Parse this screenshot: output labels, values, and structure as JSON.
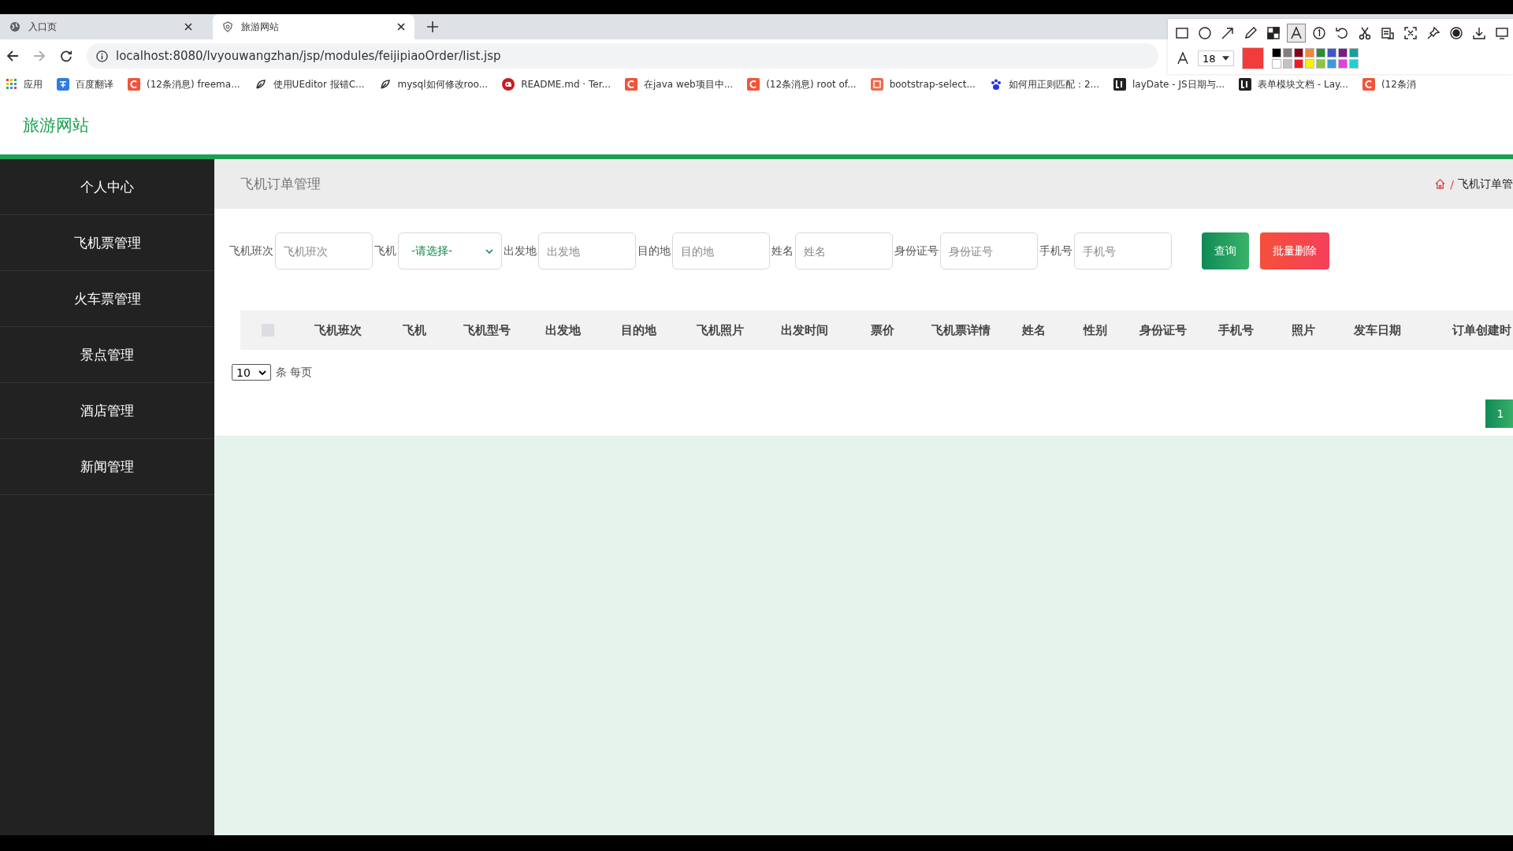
{
  "browser": {
    "tabs": [
      {
        "title": "入口页",
        "kind": "globe",
        "selected": false
      },
      {
        "title": "旅游网站",
        "kind": "shield",
        "selected": true
      }
    ],
    "address": {
      "url": "localhost:8080/lvyouwangzhan/jsp/modules/feijipiaoOrder/list.jsp",
      "forward_disabled": true
    },
    "bookmarks": [
      {
        "label": "应用",
        "kind": "apps"
      },
      {
        "label": "百度翻译",
        "kind": "translate"
      },
      {
        "label": "(12条消息) freema...",
        "kind": "csdn"
      },
      {
        "label": "使用UEditor 报错C...",
        "kind": "leaf"
      },
      {
        "label": "mysql如何修改roo...",
        "kind": "leaf"
      },
      {
        "label": "README.md · Ter...",
        "kind": "gitee"
      },
      {
        "label": "在java web项目中...",
        "kind": "csdn"
      },
      {
        "label": "(12条消息) root of...",
        "kind": "csdn"
      },
      {
        "label": "bootstrap-select...",
        "kind": "orange"
      },
      {
        "label": "如何用正则匹配：2...",
        "kind": "paw"
      },
      {
        "label": "layDate - JS日期与...",
        "kind": "layui"
      },
      {
        "label": "表单模块文档 - Lay...",
        "kind": "layui"
      },
      {
        "label": "(12条消",
        "kind": "csdn"
      }
    ]
  },
  "capture_toolbar": {
    "tools": [
      {
        "kind": "rect",
        "selected": false
      },
      {
        "kind": "ellipse",
        "selected": false
      },
      {
        "kind": "arrow",
        "selected": false
      },
      {
        "kind": "pencil",
        "selected": false
      },
      {
        "kind": "mosaic",
        "selected": false
      },
      {
        "kind": "text",
        "selected": true
      },
      {
        "kind": "number",
        "selected": false
      },
      {
        "kind": "undo",
        "selected": false
      },
      {
        "kind": "scissors",
        "selected": false
      },
      {
        "kind": "ocr",
        "selected": false
      },
      {
        "kind": "scan",
        "selected": false
      },
      {
        "kind": "pin",
        "selected": false
      },
      {
        "kind": "record",
        "selected": false
      },
      {
        "kind": "download",
        "selected": false
      },
      {
        "kind": "screen",
        "selected": false
      }
    ],
    "font_size": "18",
    "palette": [
      {
        "color": "#000000"
      },
      {
        "color": "#7f7f7f"
      },
      {
        "color": "#880015"
      },
      {
        "color": "#f0883c"
      },
      {
        "color": "#2e8b3c"
      },
      {
        "color": "#3f56cc"
      },
      {
        "color": "#7a1a8c"
      },
      {
        "color": "#16a09a"
      },
      {
        "color": "#ffffff"
      },
      {
        "color": "#c3c3c3"
      },
      {
        "color": "#ed1c24"
      },
      {
        "color": "#fff200"
      },
      {
        "color": "#8cc63f"
      },
      {
        "color": "#3a9ad9"
      },
      {
        "color": "#e040e0"
      },
      {
        "color": "#20d0d0"
      }
    ]
  },
  "site": {
    "title": "旅游网站"
  },
  "sidebar": {
    "items": [
      {
        "label": "个人中心"
      },
      {
        "label": "飞机票管理"
      },
      {
        "label": "火车票管理"
      },
      {
        "label": "景点管理"
      },
      {
        "label": "酒店管理"
      },
      {
        "label": "新闻管理"
      }
    ]
  },
  "page": {
    "title": "飞机订单管理",
    "breadcrumb_separator": "/",
    "breadcrumb": "飞机订单管"
  },
  "filters": [
    {
      "kind": "input",
      "label": "飞机班次",
      "placeholder": "飞机班次"
    },
    {
      "kind": "select",
      "label": "飞机",
      "value": "-请选择-"
    },
    {
      "kind": "input",
      "label": "出发地",
      "placeholder": "出发地"
    },
    {
      "kind": "input",
      "label": "目的地",
      "placeholder": "目的地"
    },
    {
      "kind": "input",
      "label": "姓名",
      "placeholder": "姓名"
    },
    {
      "kind": "input",
      "label": "身份证号",
      "placeholder": "身份证号"
    },
    {
      "kind": "input",
      "label": "手机号",
      "placeholder": "手机号"
    }
  ],
  "buttons": [
    {
      "kind": "search",
      "label": "查询"
    },
    {
      "kind": "delete",
      "label": "批量删除"
    }
  ],
  "table": {
    "select_all_checked": false,
    "columns": [
      "飞机班次",
      "飞机",
      "飞机型号",
      "出发地",
      "目的地",
      "飞机照片",
      "出发时间",
      "票价",
      "飞机票详情",
      "姓名",
      "性别",
      "身份证号",
      "手机号",
      "照片",
      "发车日期",
      "订单创建时"
    ]
  },
  "pagination": {
    "page_size": "10",
    "page_size_suffix": "条 每页",
    "pages": [
      {
        "label": "1",
        "selected": true
      }
    ]
  }
}
